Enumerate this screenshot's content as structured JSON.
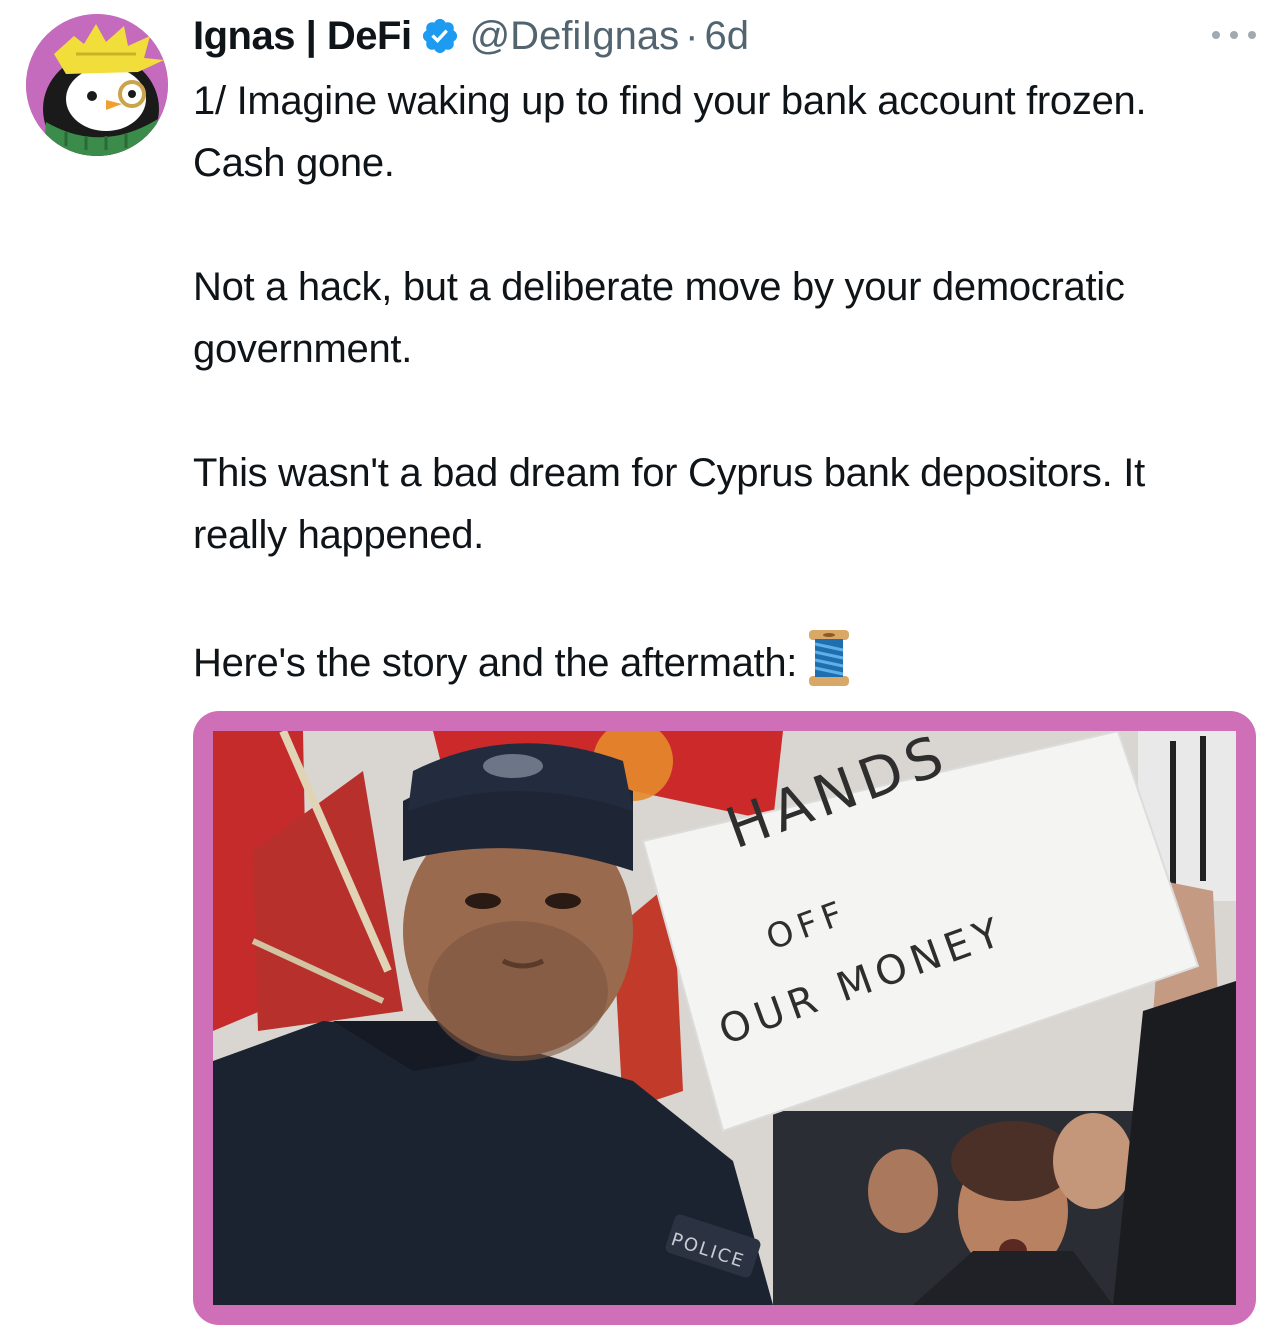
{
  "tweet": {
    "author": {
      "display_name": "Ignas | DeFi",
      "handle": "@DefiIgnas",
      "verified": true,
      "avatar_icon": "penguin-avatar-icon"
    },
    "separator": "·",
    "time": "6d",
    "more_icon": "more-dots-icon",
    "paragraphs": [
      "1/ Imagine waking up to find your bank account frozen. Cash gone.",
      "Not a hack, but a deliberate move by your democratic government.",
      "This wasn't a bad dream for Cyprus bank depositors. It really happened.",
      "Here's the story and the aftermath:"
    ],
    "thread_icon": "spool-of-thread-icon",
    "media": {
      "frame_color": "#cf6fb7",
      "sign_lines": [
        "HANDS",
        "OFF",
        "OUR MONEY"
      ],
      "badge_text": "POLICE"
    }
  },
  "colors": {
    "text_primary": "#0f1419",
    "text_secondary": "#536471",
    "verified_blue": "#1d9bf0",
    "avatar_bg": "#c56bbd"
  }
}
